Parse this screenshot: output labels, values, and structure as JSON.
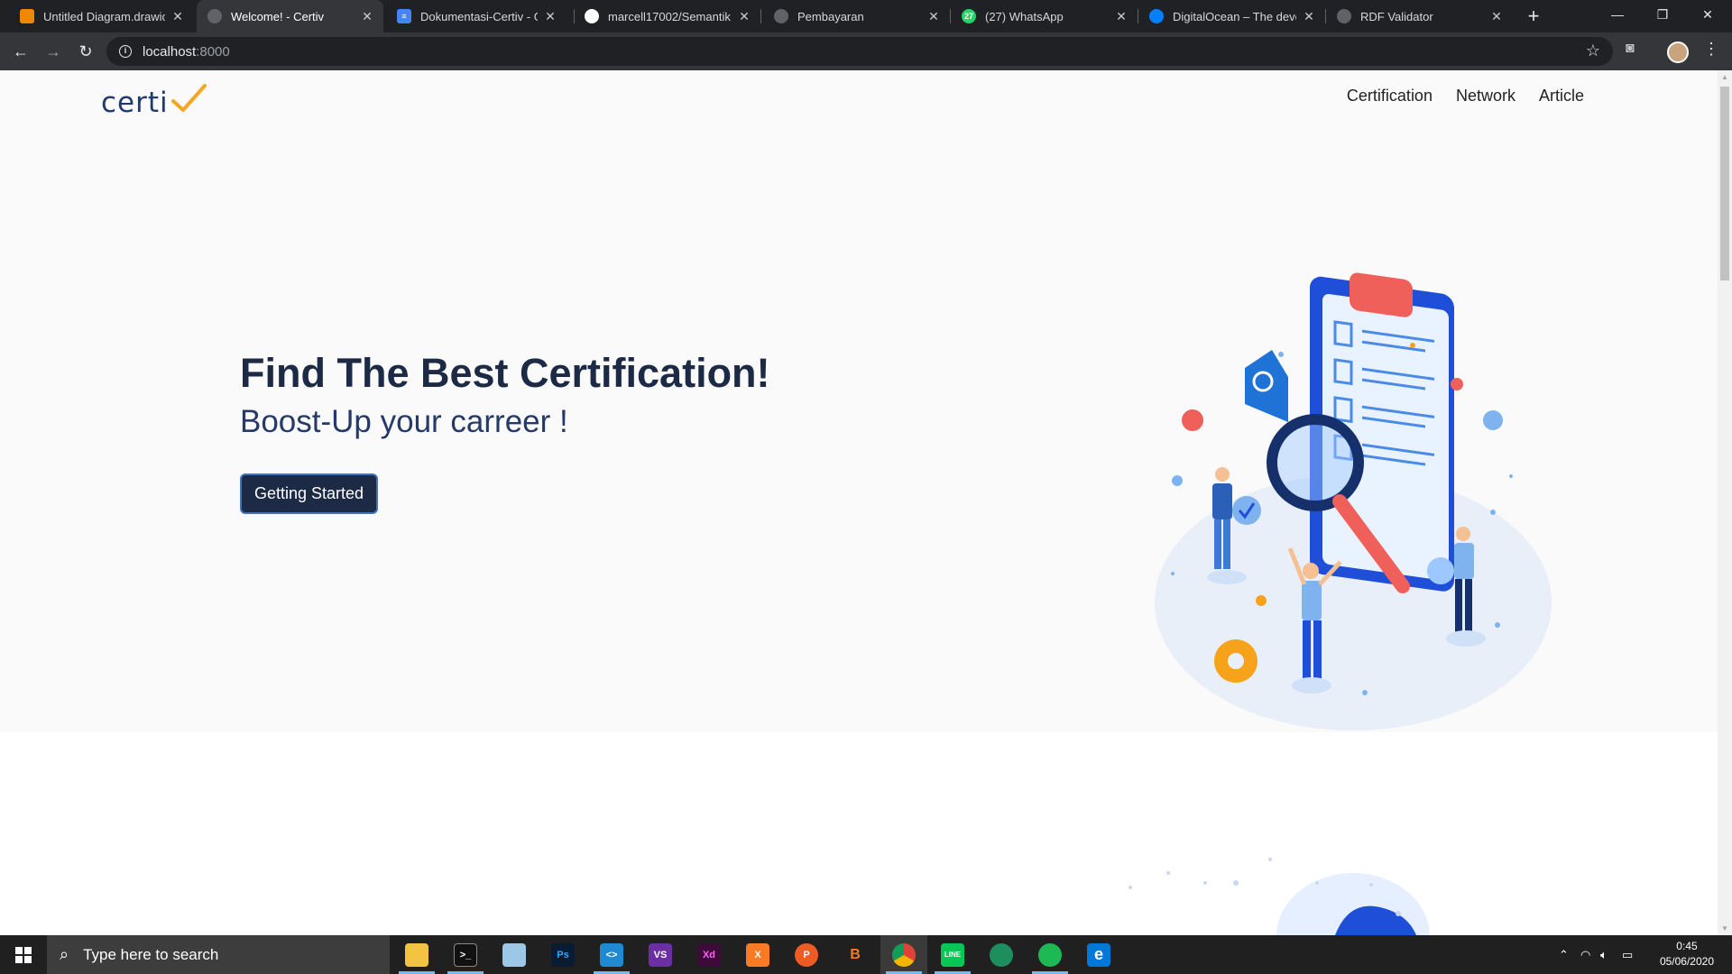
{
  "browser": {
    "tabs": [
      {
        "title": "Untitled Diagram.drawio",
        "favicon_color": "#f08705",
        "active": false
      },
      {
        "title": "Welcome! - Certiv",
        "favicon_color": "#5f6368",
        "active": true
      },
      {
        "title": "Dokumentasi-Certiv - Google Docs",
        "favicon_color": "#4285f4",
        "active": false
      },
      {
        "title": "marcell17002/Semantik",
        "favicon_color": "#ffffff",
        "active": false
      },
      {
        "title": "Pembayaran",
        "favicon_color": "#5f6368",
        "active": false
      },
      {
        "title": "(27) WhatsApp",
        "favicon_color": "#25d366",
        "active": false
      },
      {
        "title": "DigitalOcean – The developer cloud",
        "favicon_color": "#0080ff",
        "active": false
      },
      {
        "title": "RDF Validator",
        "favicon_color": "#5f6368",
        "active": false
      }
    ],
    "url_host": "localhost",
    "url_port": ":8000"
  },
  "page": {
    "logo_text": "certi",
    "nav": [
      "Certification",
      "Network",
      "Article"
    ],
    "hero_title": "Find The Best Certification!",
    "hero_subtitle": "Boost-Up your carreer !",
    "cta_label": "Getting Started"
  },
  "taskbar": {
    "search_placeholder": "Type here to search",
    "apps": [
      {
        "name": "file-explorer",
        "color": "#f5c343",
        "label": ""
      },
      {
        "name": "terminal",
        "color": "#111111",
        "label": ">_"
      },
      {
        "name": "notes",
        "color": "#9cc7e6",
        "label": ""
      },
      {
        "name": "photoshop",
        "color": "#0a1c33",
        "label": "Ps"
      },
      {
        "name": "vscode",
        "color": "#1f8ad2",
        "label": "<>"
      },
      {
        "name": "visual-studio",
        "color": "#6b2fa3",
        "label": "VS"
      },
      {
        "name": "adobe-xd",
        "color": "#3d0a3a",
        "label": "Xd"
      },
      {
        "name": "xampp",
        "color": "#fb7a24",
        "label": "X"
      },
      {
        "name": "postman",
        "color": "#ef5b25",
        "label": "P"
      },
      {
        "name": "blender",
        "color": "#202020",
        "label": "B"
      },
      {
        "name": "chrome",
        "color": "#db4437",
        "label": ""
      },
      {
        "name": "line",
        "color": "#06c755",
        "label": "LINE"
      },
      {
        "name": "maps-app",
        "color": "#1d8f5f",
        "label": ""
      },
      {
        "name": "spotify",
        "color": "#1db954",
        "label": ""
      },
      {
        "name": "edge",
        "color": "#0078d7",
        "label": "e"
      }
    ],
    "time": "0:45",
    "date": "05/06/2020"
  },
  "colors": {
    "hero_text": "#1c2a45",
    "cta_bg": "#1c2a45",
    "logo_check": "#f5a623"
  }
}
